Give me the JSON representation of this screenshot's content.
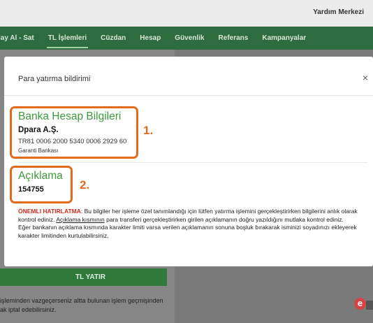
{
  "header": {
    "help_link": "Yardım Merkezi"
  },
  "nav": {
    "items": [
      {
        "label": "lay Al - Sat"
      },
      {
        "label": "TL İşlemleri"
      },
      {
        "label": "Cüzdan"
      },
      {
        "label": "Hesap"
      },
      {
        "label": "Güvenlik"
      },
      {
        "label": "Referans"
      },
      {
        "label": "Kampanyalar"
      }
    ],
    "active_index": 1
  },
  "background": {
    "deposit_button": "TL YATIR",
    "note_line1": "işleminden vazgeçerseniz altta bulunan işlem geçmişinden",
    "note_line2": "ak iptal edebilirsiniz.",
    "logo_letter": "e"
  },
  "modal": {
    "title": "Para yatırma bildirimi",
    "close_glyph": "×",
    "bank": {
      "heading": "Banka Hesap Bilgileri",
      "company": "Dpara A.Ş.",
      "iban": "TR81 0006 2000 5340 0006 2929 60",
      "bank_name": "Garanti Bankası"
    },
    "description": {
      "heading": "Açıklama",
      "value": "154755"
    },
    "markers": {
      "one": "1.",
      "two": "2."
    },
    "notice": {
      "warn_label": "ÖNEMLI HATIRLATMA",
      "p1_part1": ": Bu bilgiler her işleme özel tanımlandığı için lütfen yatırma işlemini gerçekleştirirken bilgilerini anlık olarak kontrol ediniz. ",
      "p1_link": "Açıklama kısmının",
      "p1_part2": " para transferi gerçekleştirirken girilen açıklamanın doğru yazıldığını mutlaka kontrol ediniz.",
      "p2": "Eğer bankanın açıklama kısmında karakter limiti varsa verilen açıklamanın sonuna boşluk bırakarak isminizi soyadınızı ekleyerek karakter limitinden kurtulabilirsiniz."
    }
  },
  "colors": {
    "nav_bg": "#2e6b3e",
    "accent_green": "#3d9b3d",
    "highlight_orange": "#e26a1c",
    "warning_red": "#d42a1e",
    "button_green": "#2f7a3a"
  }
}
